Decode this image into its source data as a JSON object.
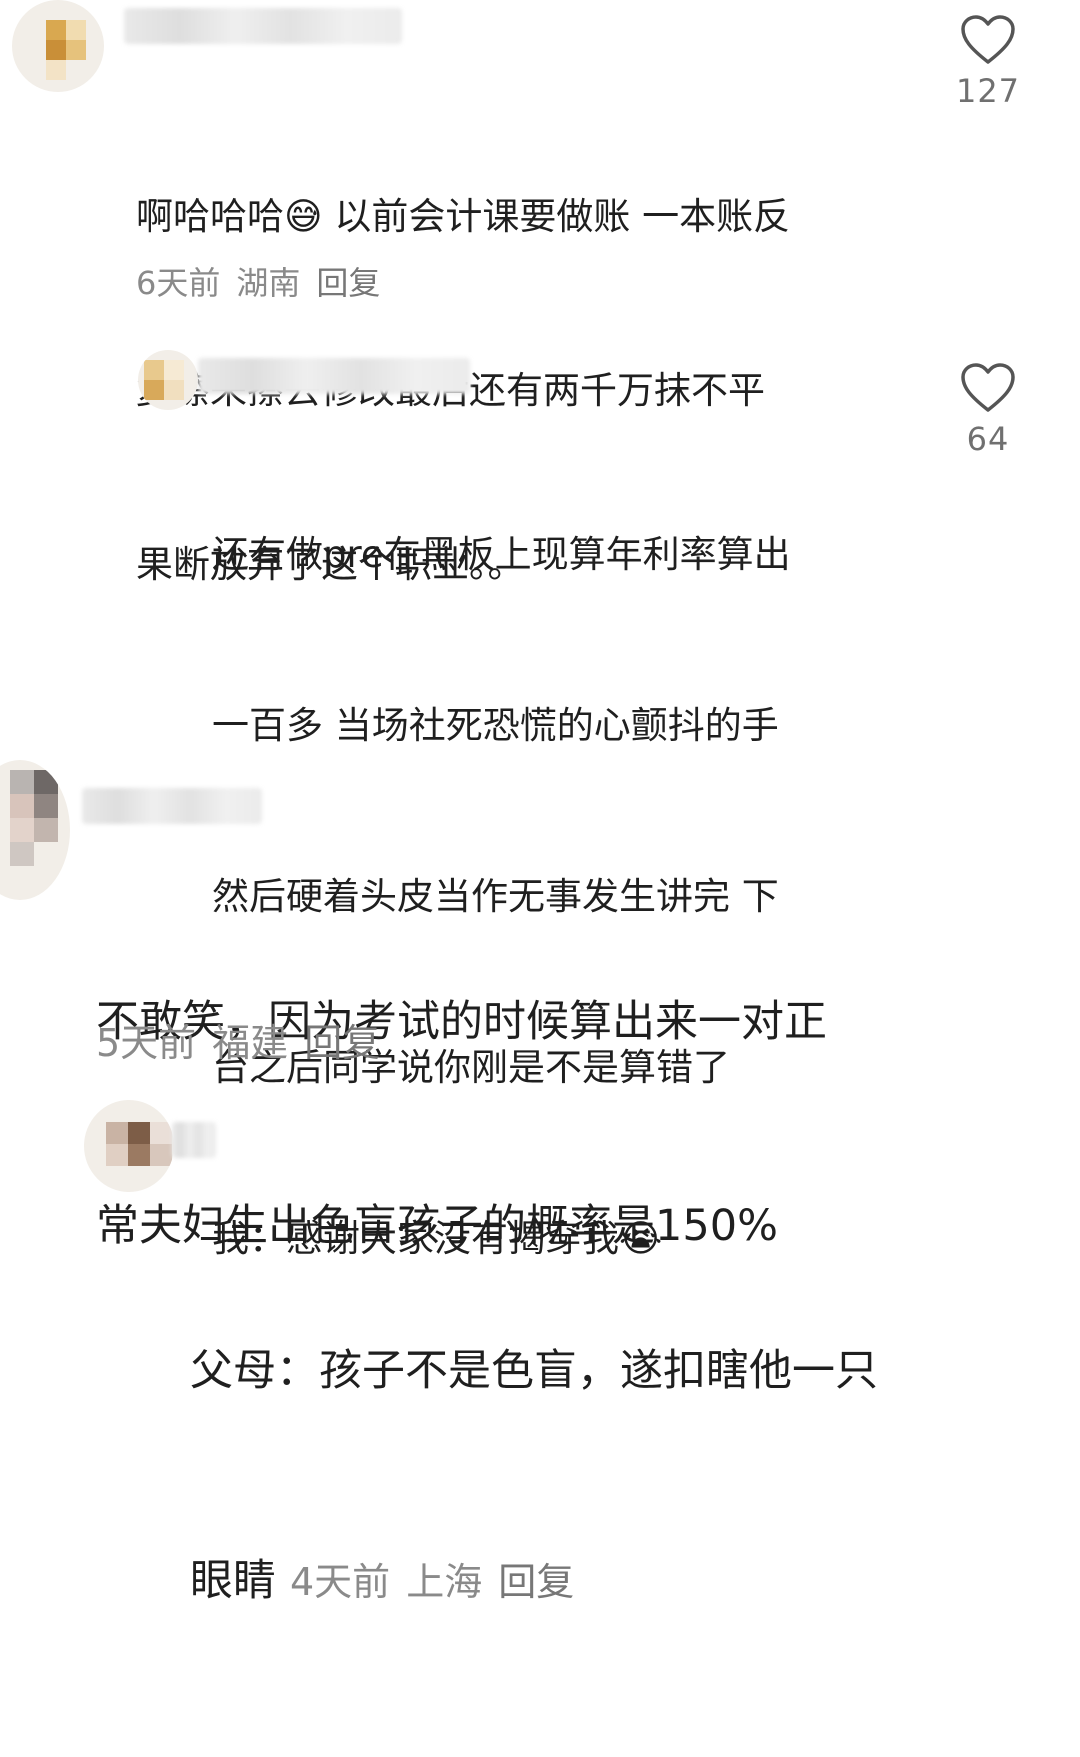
{
  "comments": [
    {
      "text_lines": [
        "啊哈哈哈😅 以前会计课要做账 一本账反",
        "复擦来擦去修改最后还有两千万抹不平",
        "果断放弃了这个职业。。"
      ],
      "time": "6天前",
      "location": "湖南",
      "reply_label": "回复",
      "likes": "127",
      "icons": {
        "like": "heart-outline-icon",
        "emoji": "grinning-sweat-emoji"
      }
    },
    {
      "text_lines": [
        "还有做pre在黑板上现算年利率算出",
        "一百多 当场社死恐慌的心颤抖的手",
        "然后硬着头皮当作无事发生讲完 下",
        "台之后同学说你刚是不是算错了",
        "我：感谢大家没有揭穿我😭"
      ],
      "likes": "64",
      "icons": {
        "like": "heart-outline-icon",
        "emoji": "loudly-crying-emoji"
      }
    },
    {
      "text_lines": [
        "不敢笑，因为考试的时候算出来一对正",
        "常夫妇生出色盲孩子的概率是150%"
      ],
      "time": "5天前",
      "location": "福建",
      "reply_label": "回复",
      "icons": {
        "emoji": "shocked-blob-emoji"
      }
    },
    {
      "text_lines": [
        "父母：孩子不是色盲，遂扣瞎他一只",
        "眼睛"
      ],
      "time": "4天前",
      "location": "上海",
      "reply_label": "回复"
    }
  ],
  "colors": {
    "text": "#1f1f1f",
    "meta": "#8a8a8a",
    "like_icon": "#555555",
    "background": "#ffffff"
  }
}
